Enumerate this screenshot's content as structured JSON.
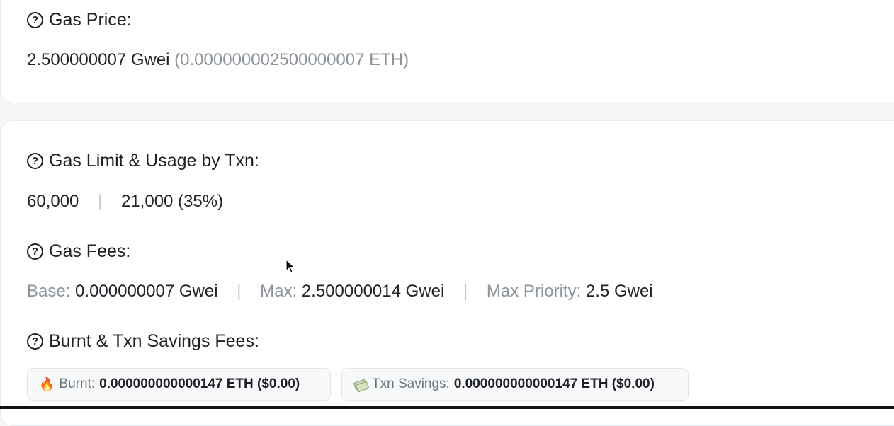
{
  "gas_price": {
    "label": "Gas Price:",
    "value": "2.500000007 Gwei",
    "eth": "(0.000000002500000007 ETH)"
  },
  "gas_limit": {
    "label": "Gas Limit & Usage by Txn:",
    "limit": "60,000",
    "separator": "|",
    "usage": "21,000 (35%)"
  },
  "gas_fees": {
    "label": "Gas Fees:",
    "base_label": "Base:",
    "base_value": "0.000000007 Gwei",
    "max_label": "Max:",
    "max_value": "2.500000014 Gwei",
    "priority_label": "Max Priority:",
    "priority_value": "2.5 Gwei",
    "separator": "|"
  },
  "burnt_savings": {
    "label": "Burnt & Txn Savings Fees:",
    "burnt_icon": "fire-icon",
    "burnt_label": "Burnt:",
    "burnt_value": "0.000000000000147 ETH ($0.00)",
    "savings_icon": "money-icon",
    "savings_label": "Txn Savings:",
    "savings_value": "0.000000000000147 ETH ($0.00)"
  },
  "help_icon_glyph": "?",
  "fire_glyph": "🔥"
}
